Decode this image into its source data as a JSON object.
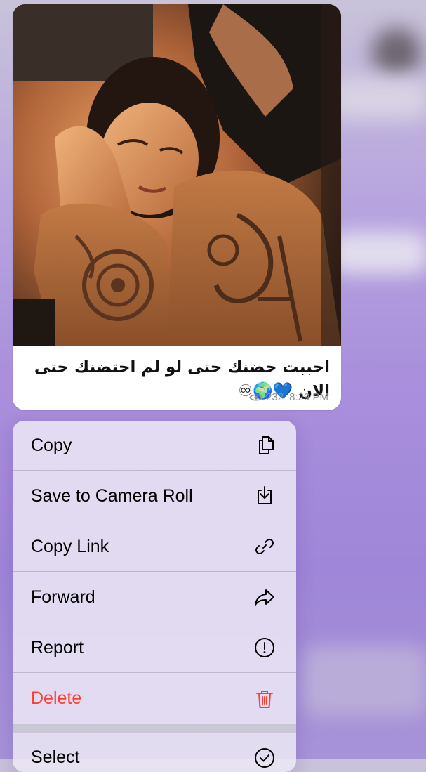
{
  "message": {
    "caption_line1": "احببت حضنك حتى لو لم احتضنك حتى",
    "caption_line2": "الان 💙🌍♾",
    "views": "232",
    "time": "8:29 PM"
  },
  "context_menu": {
    "items": [
      {
        "label": "Copy",
        "icon": "copy-icon"
      },
      {
        "label": "Save to Camera Roll",
        "icon": "download-icon"
      },
      {
        "label": "Copy Link",
        "icon": "link-icon"
      },
      {
        "label": "Forward",
        "icon": "forward-icon"
      },
      {
        "label": "Report",
        "icon": "report-icon"
      },
      {
        "label": "Delete",
        "icon": "trash-icon"
      },
      {
        "label": "Select",
        "icon": "select-icon"
      }
    ]
  },
  "colors": {
    "danger": "#ff3b30",
    "meta": "#8e8e93"
  }
}
